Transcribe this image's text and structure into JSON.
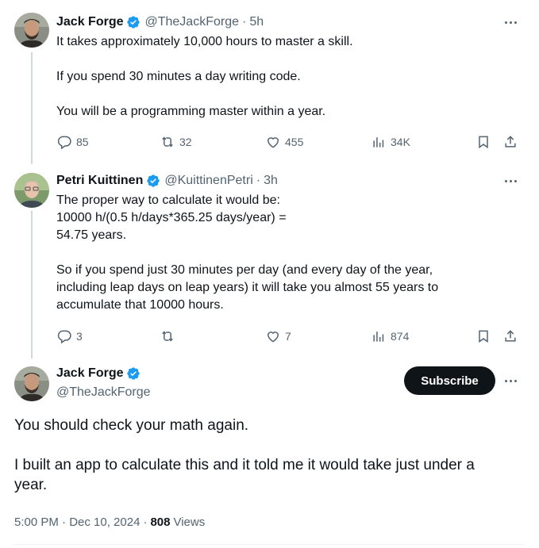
{
  "tweets": [
    {
      "name": "Jack Forge",
      "handle": "@TheJackForge",
      "separator": "·",
      "time": "5h",
      "text": "It takes approximately 10,000 hours to master a skill.\n\nIf you spend 30 minutes a day writing code.\n\nYou will be a programming master within a year.",
      "replies": "85",
      "reposts": "32",
      "likes": "455",
      "views": "34K"
    },
    {
      "name": "Petri Kuittinen",
      "handle": "@KuittinenPetri",
      "separator": "·",
      "time": "3h",
      "text": "The proper way to calculate it would be:\n10000 h/(0.5 h/days*365.25 days/year) =\n54.75 years.\n\nSo if you spend just 30 minutes per day (and every day of the year,\nincluding leap days on leap years) it will take you almost 55 years to\naccumulate that 10000 hours.",
      "replies": "3",
      "reposts": "",
      "likes": "7",
      "views": "874"
    }
  ],
  "main": {
    "name": "Jack Forge",
    "handle": "@TheJackForge",
    "subscribe_label": "Subscribe",
    "text": "You should check your math again.\n\nI built an app to calculate this and it told me it would take just under a\nyear.",
    "timestamp": "5:00 PM · Dec 10, 2024",
    "separator": "·",
    "views_count": "808",
    "views_label": "Views"
  },
  "colors": {
    "verified": "#1d9bf0",
    "secondary_text": "#536471",
    "subscribe_bg": "#0f1419",
    "thread_line": "#cfd9de"
  },
  "icons": [
    "verified-badge-icon",
    "more-icon",
    "reply-icon",
    "repost-icon",
    "like-icon",
    "views-icon",
    "bookmark-icon",
    "share-icon"
  ]
}
